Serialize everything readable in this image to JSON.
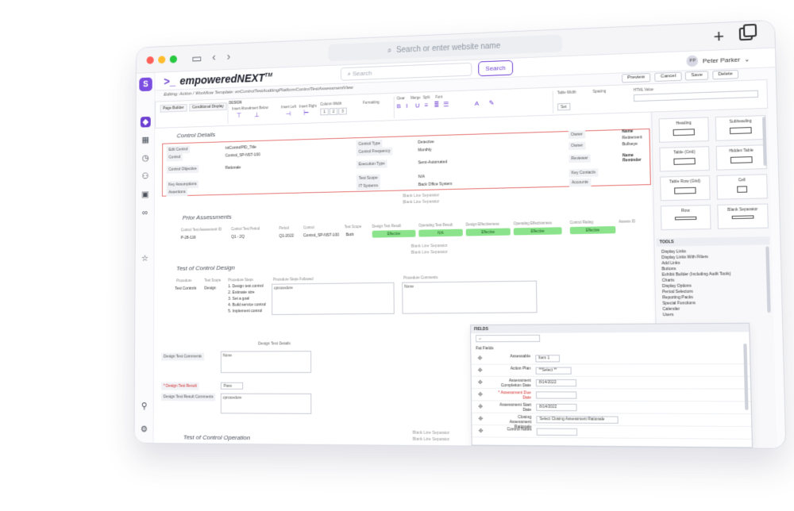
{
  "browser": {
    "url_placeholder": "Search or enter website name"
  },
  "app": {
    "brand": "empoweredNEXT",
    "brand_mark": "TM",
    "search_placeholder": "Search",
    "search_button": "Search",
    "user_name": "Peter Parker",
    "user_initials": "PP"
  },
  "editor": {
    "path": "Editing: Action / Workflow Template: enControlTestAuditingPlatformControlTestAssessmentView",
    "actions": [
      "Preview",
      "Cancel",
      "Save",
      "Delete"
    ]
  },
  "ribbon": {
    "tabs": [
      "Page Builder",
      "Conditional Display"
    ],
    "design_label": "DESIGN",
    "labels": [
      "Insert Above",
      "Insert Below",
      "Insert Left",
      "Insert Right",
      "Column Width",
      "Formatting",
      "Clear",
      "Merge",
      "Split",
      "Font",
      "Table Width",
      "Spacing",
      "HTML Value"
    ],
    "columns": [
      "1",
      "2",
      "3"
    ],
    "set_label": "Set"
  },
  "control_details": {
    "title": "Control Details",
    "fields": [
      {
        "label": "Edit Control",
        "value": "txtControlPID_Title"
      },
      {
        "label": "Control",
        "value": "Control_SP-NST-100"
      },
      {
        "label": "Control Objective",
        "value": "Rationale"
      },
      {
        "label": "Key Assumptions",
        "value": ""
      },
      {
        "label": "Assertions",
        "value": ""
      }
    ],
    "mid_fields": [
      {
        "label": "Control Type",
        "value": "Detective"
      },
      {
        "label": "Control Frequency",
        "value": "Monthly"
      },
      {
        "label": "Execution Type",
        "value": "Semi-Automated"
      },
      {
        "label": "Test Scope",
        "value": "N/A"
      },
      {
        "label": "IT Systems",
        "value": "Back Office System"
      }
    ],
    "right_fields": [
      {
        "label": "Owner",
        "value": ""
      },
      {
        "label": "Owner",
        "value": ""
      },
      {
        "label": "Reviewer",
        "value": ""
      },
      {
        "label": "Key Contacts",
        "value": ""
      },
      {
        "label": "Accounts",
        "value": ""
      }
    ],
    "far_right": [
      "Name",
      "Retirement",
      "Bullseye",
      "Name Reminder"
    ]
  },
  "separators": {
    "blank_line": "Blank Line Separator"
  },
  "prior_assessments": {
    "title": "Prior Assessments",
    "headers": [
      "Control Test Assessment ID",
      "Control Test Period",
      "Period",
      "Control",
      "Test Scope",
      "Design Test Result",
      "Operating Test Result",
      "Design Effectiveness",
      "Operating Effectiveness",
      "Control Rating",
      "Assess ID"
    ],
    "row": [
      "P-28-116",
      "Q1 - 2Q",
      "Q1-2022",
      "Control_SP-NST-100",
      "Both",
      "Effective",
      "N/A",
      "Effective",
      "Effective",
      "Effective"
    ]
  },
  "test_design": {
    "title": "Test of Control Design",
    "headers": [
      "Procedure",
      "Test Scope",
      "Procedure Steps",
      "Procedure Steps Followed",
      "Procedure Comments"
    ],
    "procedure": "Test Controls",
    "scope": "Design",
    "steps": [
      "1. Design test control",
      "2. Estimate size",
      "3. Set a goal",
      "4. Build service control",
      "5. Implement control"
    ],
    "followed": "cprocedure",
    "comments": "None"
  },
  "design_test_details": {
    "title": "Design Test Details",
    "fields": [
      {
        "label": "Design Test Comments",
        "value": "None"
      },
      {
        "label": "* Design Test Result",
        "value": "Pass"
      },
      {
        "label": "Design Test Result Comments",
        "value": "cprocedure"
      }
    ]
  },
  "test_operation": {
    "title": "Test of Control Operation"
  },
  "widgets": [
    "Heading",
    "Subheading",
    "Table (Grid)",
    "Hidden Table",
    "Table Row (Grid)",
    "Cell",
    "Row",
    "Blank Separator"
  ],
  "tools": {
    "title": "TOOLS",
    "items": [
      "Display Links",
      "Display Links With Filters",
      "Add Links",
      "Buttons",
      "Exhibit Builder (Including Audit Tools)",
      "Charts",
      "Display Options",
      "Period Selectors",
      "Reporting Packs",
      "Special Functions",
      "Calendar",
      "Users"
    ]
  },
  "fields_panel": {
    "title": "FIELDS",
    "group": "Fat Fields",
    "rows": [
      {
        "label": "Assessable",
        "value": "Item 1",
        "required": false
      },
      {
        "label": "Action Plan",
        "value": "**Select **",
        "required": false
      },
      {
        "label": "Assessment Completion Date",
        "value": "8/14/2022",
        "required": false
      },
      {
        "label": "* Assessment Due Date",
        "value": "",
        "required": true
      },
      {
        "label": "Assessment Start Date",
        "value": "8/14/2022",
        "required": false
      },
      {
        "label": "Closing Assessment Rationale",
        "value": "Select Closing Assessment Rationale",
        "required": false
      },
      {
        "label": "Control Notes",
        "value": "",
        "required": false
      }
    ]
  }
}
